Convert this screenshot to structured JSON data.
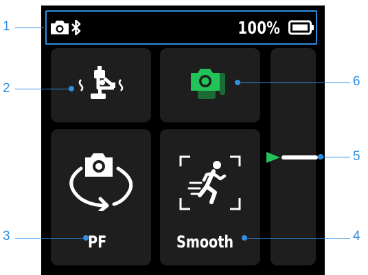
{
  "status_bar": {
    "camera_icon": "camera-bluetooth-icon",
    "battery_percent": "100%",
    "battery_icon": "battery-full-icon"
  },
  "tiles": {
    "balance": {
      "icon": "gimbal-balance-icon"
    },
    "camera": {
      "icon": "phone-camera-icon",
      "icon_color": "#22c45a"
    },
    "pf": {
      "icon": "camera-rotate-icon",
      "label": "PF"
    },
    "smooth": {
      "icon": "running-person-icon",
      "label": "Smooth"
    }
  },
  "slider": {
    "indicator_color": "#22c45a",
    "icon": "slider-pointer-icon"
  },
  "callouts": [
    "1",
    "2",
    "3",
    "4",
    "5",
    "6"
  ],
  "colors": {
    "callout": "#2f8fe0",
    "screen": "#000000",
    "tile": "#1e1e1e"
  }
}
